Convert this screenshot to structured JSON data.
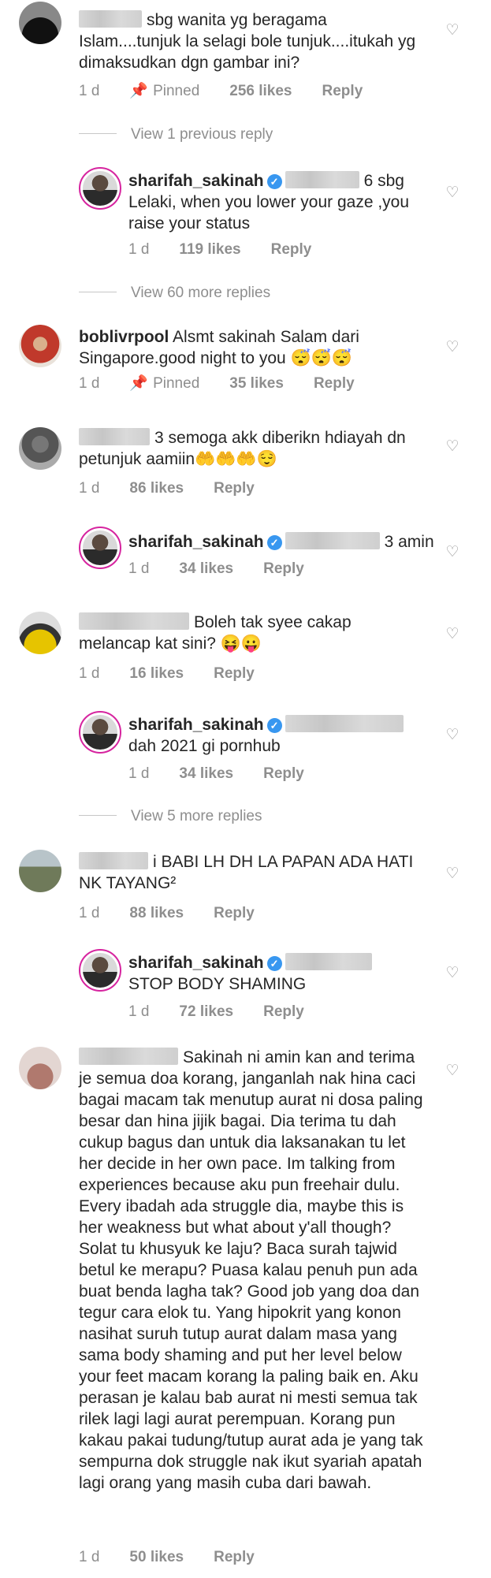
{
  "comments": [
    {
      "username": "",
      "text": "sbg wanita yg beragama Islam....tunjuk la selagi bole tunjuk....itukah yg dimaksudkan dgn gambar ini?",
      "time": "1 d",
      "pinned": "Pinned",
      "likes": "256 likes",
      "reply": "Reply"
    },
    {
      "view_more": "View 1 previous reply",
      "username": "sharifah_sakinah",
      "mention_suffix": "6 sbg",
      "text": "Lelaki, when you lower your gaze ,you raise your status",
      "time": "1 d",
      "likes": "119 likes",
      "reply": "Reply"
    },
    {
      "view_more": "View 60 more replies"
    },
    {
      "username": "boblivrpool",
      "text": "Alsmt sakinah Salam dari Singapore.good night to you 😴😴😴",
      "time": "1 d",
      "pinned": "Pinned",
      "likes": "35 likes",
      "reply": "Reply"
    },
    {
      "username": "",
      "text": "3 semoga akk diberikn hdiayah dn petunjuk aamiin🤲🤲🤲😌",
      "time": "1 d",
      "likes": "86 likes",
      "reply": "Reply"
    },
    {
      "username": "sharifah_sakinah",
      "text": "3 amin",
      "time": "1 d",
      "likes": "34 likes",
      "reply": "Reply"
    },
    {
      "username": "",
      "text": "Boleh tak syee cakap melancap kat sini? 😝😛",
      "time": "1 d",
      "likes": "16 likes",
      "reply": "Reply"
    },
    {
      "username": "sharifah_sakinah",
      "text": "dah 2021 gi pornhub",
      "time": "1 d",
      "likes": "34 likes",
      "reply": "Reply"
    },
    {
      "view_more": "View 5 more replies"
    },
    {
      "username": "",
      "text": "i BABI LH DH LA PAPAN ADA HATI NK TAYANG²",
      "time": "1 d",
      "likes": "88 likes",
      "reply": "Reply"
    },
    {
      "username": "sharifah_sakinah",
      "text": "STOP BODY SHAMING",
      "time": "1 d",
      "likes": "72 likes",
      "reply": "Reply"
    },
    {
      "username": "",
      "text": "Sakinah ni amin kan and terima je semua doa korang, janganlah nak hina caci bagai macam tak menutup aurat ni dosa paling besar dan hina jijik bagai. Dia terima tu dah cukup bagus dan untuk dia laksanakan tu let her decide in her own pace. Im talking from experiences because aku pun freehair dulu. Every ibadah ada struggle dia, maybe this is her weakness but what about y'all though? Solat tu khusyuk ke laju? Baca surah tajwid betul ke merapu? Puasa kalau penuh pun ada buat benda lagha tak? Good job yang doa dan tegur cara elok tu. Yang hipokrit yang konon nasihat suruh tutup aurat dalam masa yang sama body shaming and put her level below your feet macam korang la paling baik en. Aku perasan je kalau bab aurat ni mesti semua tak rilek lagi lagi aurat perempuan. Korang pun kakau pakai tudung/tutup aurat ada je yang tak sempurna dok struggle nak ikut syariah apatah lagi orang yang masih cuba dari bawah.",
      "time": "1 d",
      "likes": "50 likes",
      "reply": "Reply"
    }
  ],
  "icons": {
    "like": "heart-outline-icon",
    "pin": "pin-icon",
    "verified": "verified-badge-icon"
  },
  "colors": {
    "meta": "#8e8e8e",
    "verified": "#3897f0",
    "text": "#262626"
  }
}
